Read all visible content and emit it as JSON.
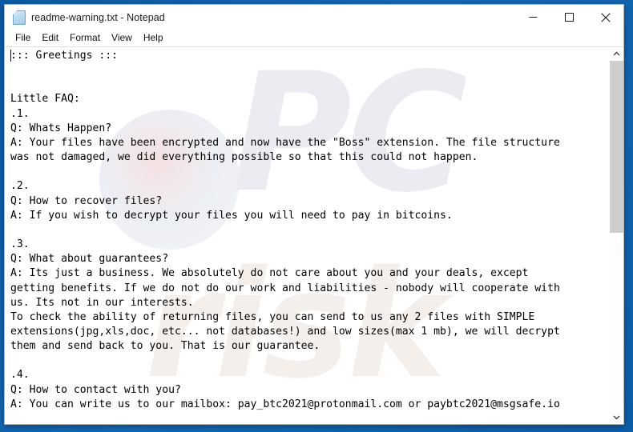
{
  "window": {
    "title": "readme-warning.txt - Notepad",
    "icon": "notepad-icon",
    "controls": {
      "minimize": "minimize",
      "maximize": "maximize",
      "close": "close"
    }
  },
  "menubar": {
    "items": [
      {
        "label": "File"
      },
      {
        "label": "Edit"
      },
      {
        "label": "Format"
      },
      {
        "label": "View"
      },
      {
        "label": "Help"
      }
    ]
  },
  "editor": {
    "text": "::: Greetings :::\n\n\nLittle FAQ:\n.1.\nQ: Whats Happen?\nA: Your files have been encrypted and now have the \"Boss\" extension. The file structure\nwas not damaged, we did everything possible so that this could not happen.\n\n.2.\nQ: How to recover files?\nA: If you wish to decrypt your files you will need to pay in bitcoins.\n\n.3.\nQ: What about guarantees?\nA: Its just a business. We absolutely do not care about you and your deals, except\ngetting benefits. If we do not do our work and liabilities - nobody will cooperate with\nus. Its not in our interests.\nTo check the ability of returning files, you can send to us any 2 files with SIMPLE\nextensions(jpg,xls,doc, etc... not databases!) and low sizes(max 1 mb), we will decrypt\nthem and send back to you. That is our guarantee.\n\n.4.\nQ: How to contact with you?\nA: You can write us to our mailbox: pay_btc2021@protonmail.com or paybtc2021@msgsafe.io"
  },
  "watermark": {
    "primary": "PC",
    "secondary": "risk"
  },
  "scrollbar": {
    "up_arrow": "scroll-up",
    "down_arrow": "scroll-down"
  },
  "colors": {
    "desktop": "#1268b4",
    "window_bg": "#ffffff",
    "text": "#000000",
    "scroll_thumb": "#cdcdcd"
  }
}
